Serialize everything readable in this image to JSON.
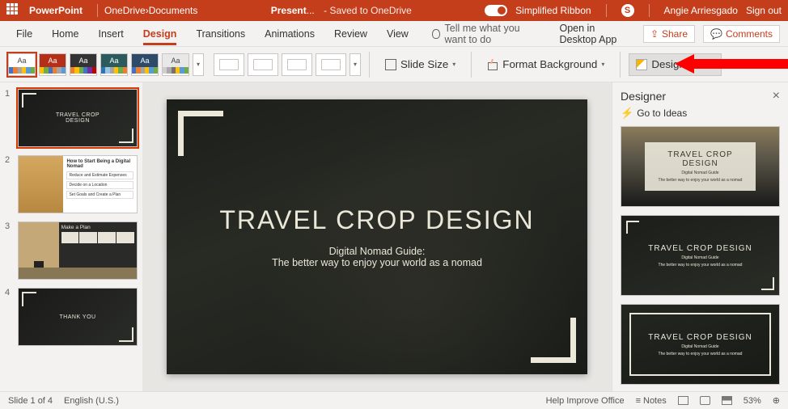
{
  "topbar": {
    "appname": "PowerPoint",
    "breadcrumb_root": "OneDrive",
    "breadcrumb_leaf": "Documents",
    "filename": "Present",
    "filename_dots": "...",
    "saved_text": "-  Saved to OneDrive",
    "simplified_ribbon": "Simplified Ribbon",
    "skype_letter": "S",
    "username": "Angie Arriesgado",
    "signout": "Sign out"
  },
  "tabs": {
    "file": "File",
    "home": "Home",
    "insert": "Insert",
    "design": "Design",
    "transitions": "Transitions",
    "animations": "Animations",
    "review": "Review",
    "view": "View",
    "tellme": "Tell me what you want to do",
    "open_desktop": "Open in Desktop App",
    "share": "Share",
    "comments": "Comments"
  },
  "ribbon": {
    "aa": "Aa",
    "slide_size": "Slide Size",
    "format_bg": "Format Background",
    "design_ideas": "Design Ideas"
  },
  "thumbs": {
    "n1": "1",
    "n2": "2",
    "n3": "3",
    "n4": "4",
    "t1_title": "TRAVEL CROP\nDESIGN",
    "t2_title": "How to Start Being a Digital Nomad",
    "t2_i1": "Reduce and Estimate Expenses",
    "t2_i2": "Decide on a Location",
    "t2_i3": "Set Goals and Create a Plan",
    "t3_title": "Make a Plan",
    "t4_title": "THANK YOU"
  },
  "slide": {
    "title": "TRAVEL CROP DESIGN",
    "sub1": "Digital Nomad Guide:",
    "sub2": "The better way to enjoy your world as a nomad"
  },
  "designer": {
    "header": "Designer",
    "goto": "Go to Ideas",
    "idea_title": "TRAVEL CROP DESIGN",
    "idea_sub1": "Digital Nomad Guide",
    "idea_sub2": "The better way to enjoy your world as a nomad"
  },
  "status": {
    "slide_of": "Slide 1 of 4",
    "lang": "English (U.S.)",
    "help": "Help Improve Office",
    "notes": "Notes",
    "zoom": "53%"
  }
}
